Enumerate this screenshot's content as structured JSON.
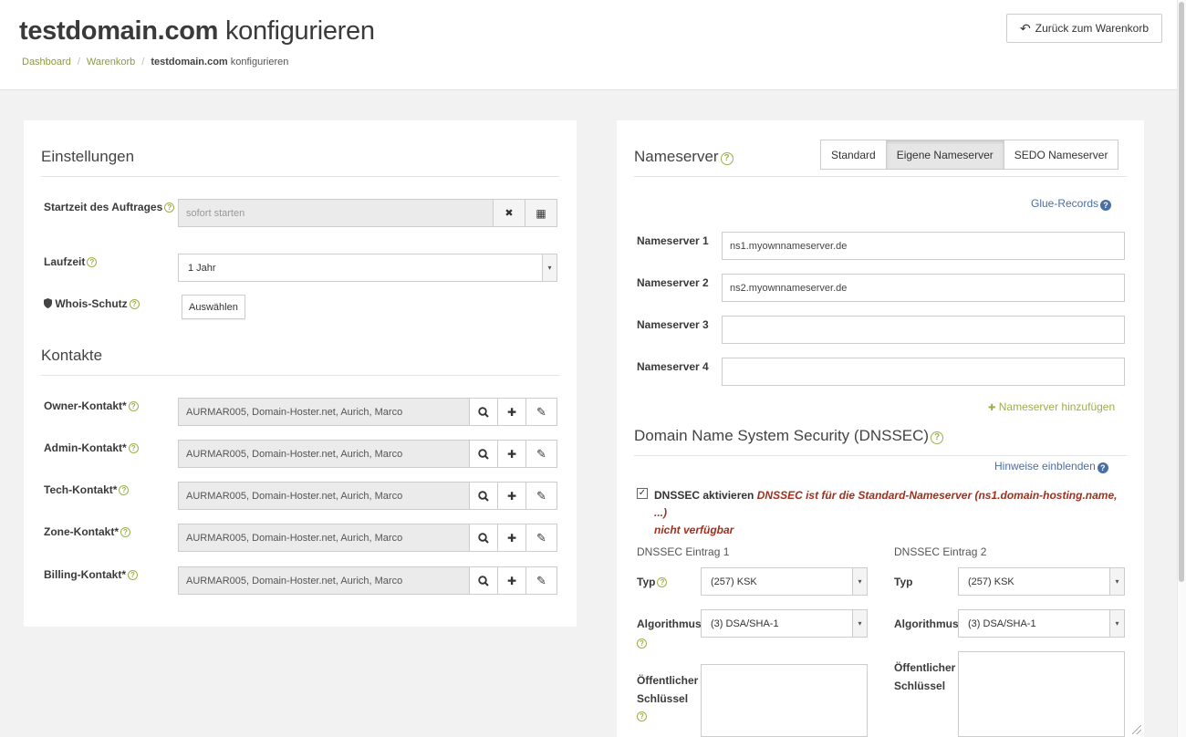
{
  "header": {
    "title_domain": "testdomain.com",
    "title_suffix": "konfigurieren",
    "back_button": "Zurück zum Warenkorb",
    "breadcrumb": {
      "items": [
        "Dashboard",
        "Warenkorb"
      ],
      "current_bold": "testdomain.com",
      "current_rest": "konfigurieren"
    }
  },
  "settings": {
    "title": "Einstellungen",
    "start_label": "Startzeit des Auftrages",
    "start_placeholder": "sofort starten",
    "runtime_label": "Laufzeit",
    "runtime_value": "1 Jahr",
    "whois_label": "Whois-Schutz",
    "whois_button": "Auswählen"
  },
  "contacts": {
    "title": "Kontakte",
    "items": [
      {
        "label": "Owner-Kontakt*",
        "value": "AURMAR005, Domain-Hoster.net, Aurich, Marco"
      },
      {
        "label": "Admin-Kontakt*",
        "value": "AURMAR005, Domain-Hoster.net, Aurich, Marco"
      },
      {
        "label": "Tech-Kontakt*",
        "value": "AURMAR005, Domain-Hoster.net, Aurich, Marco"
      },
      {
        "label": "Zone-Kontakt*",
        "value": "AURMAR005, Domain-Hoster.net, Aurich, Marco"
      },
      {
        "label": "Billing-Kontakt*",
        "value": "AURMAR005, Domain-Hoster.net, Aurich, Marco"
      }
    ]
  },
  "nameserver": {
    "title": "Nameserver",
    "tabs": [
      "Standard",
      "Eigene Nameserver",
      "SEDO Nameserver"
    ],
    "active_tab": "Eigene Nameserver",
    "glue_records": "Glue-Records",
    "rows": [
      {
        "label": "Nameserver 1",
        "value": "ns1.myownnameserver.de"
      },
      {
        "label": "Nameserver 2",
        "value": "ns2.myownnameserver.de"
      },
      {
        "label": "Nameserver 3",
        "value": ""
      },
      {
        "label": "Nameserver 4",
        "value": ""
      }
    ],
    "add_link": "Nameserver hinzufügen"
  },
  "dnssec": {
    "title": "Domain Name System Security (DNSSEC)",
    "hints_link": "Hinweise einblenden",
    "checkbox_label": "DNSSEC aktivieren",
    "checkbox_checked": true,
    "warning": "DNSSEC ist für die Standard-Nameserver (ns1.domain-hosting.name, ...) nicht verfügbar",
    "warning_line1": "DNSSEC ist für die Standard-Nameserver (ns1.domain-hosting.name, ...)",
    "warning_line2": "nicht verfügbar",
    "entries": [
      {
        "title": "DNSSEC Eintrag 1",
        "type_label": "Typ",
        "type_value": "(257) KSK",
        "algo_label": "Algorithmus",
        "algo_value": "(3) DSA/SHA-1",
        "key_label_1": "Öffentlicher",
        "key_label_2": "Schlüssel"
      },
      {
        "title": "DNSSEC Eintrag 2",
        "type_label": "Typ",
        "type_value": "(257) KSK",
        "algo_label": "Algorithmus",
        "algo_value": "(3) DSA/SHA-1",
        "key_label_1": "Öffentlicher",
        "key_label_2": "Schlüssel"
      }
    ]
  },
  "icons": {
    "help": "?",
    "close": "✖",
    "calendar": "▦",
    "search": "search-icon",
    "plus": "✚",
    "edit": "✎",
    "back": "↶",
    "shield": "shield-icon",
    "caret": "▾",
    "check": "✓"
  },
  "colors": {
    "accent_green": "#9bb04a",
    "link_blue": "#4a6fa5",
    "warning_red": "#a0301e"
  }
}
